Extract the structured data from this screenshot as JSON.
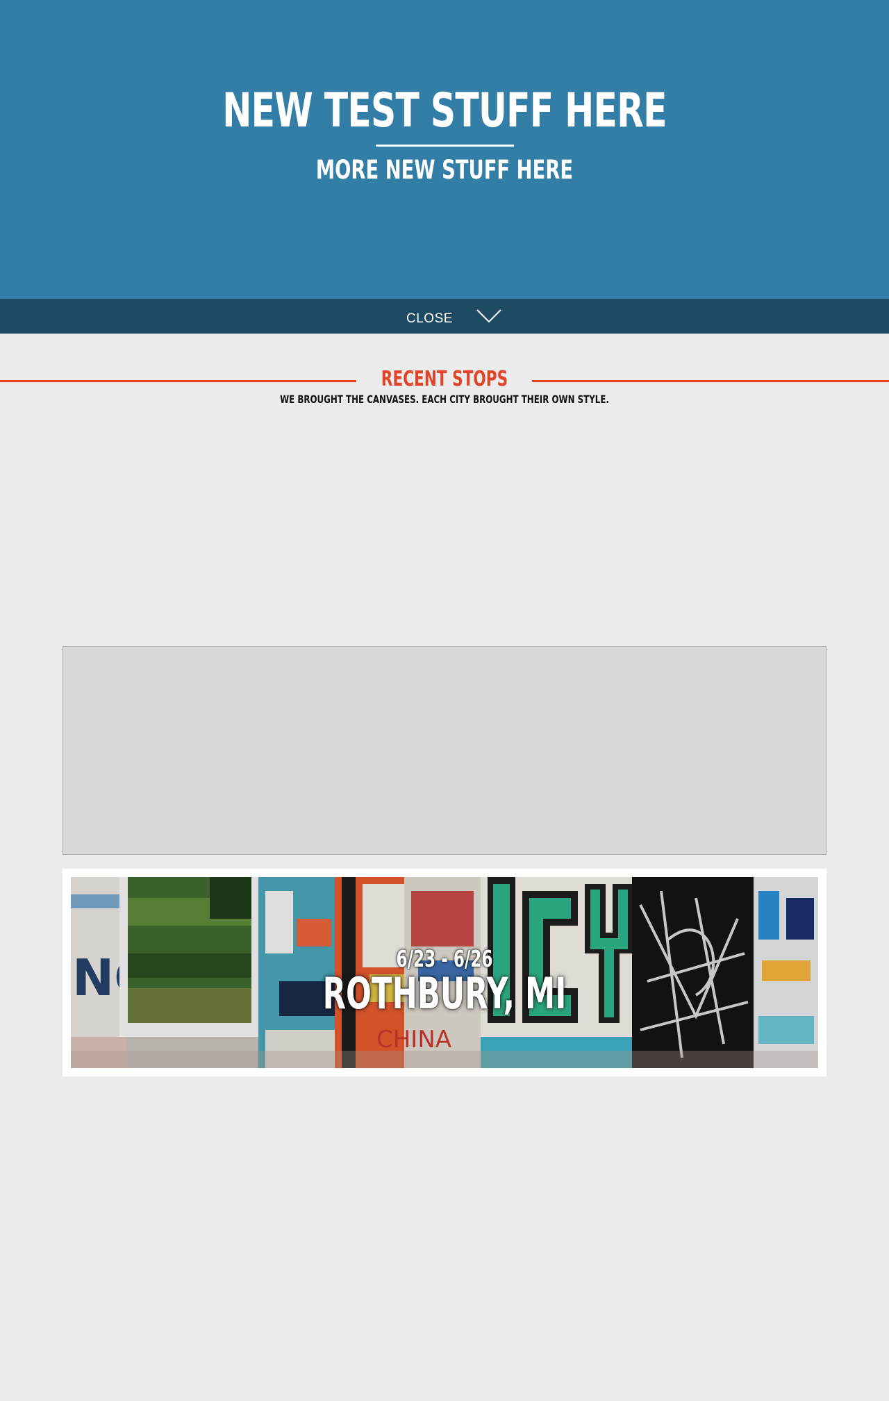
{
  "hero": {
    "title": "NEW TEST STUFF HERE",
    "subtitle": "MORE NEW STUFF HERE",
    "background_color": "#337ea6"
  },
  "close_bar": {
    "label": "CLOSE",
    "icon": "chevron-down-icon",
    "background_color": "#1f4a63"
  },
  "recent_stops": {
    "title": "RECENT STOPS",
    "subtitle": "WE BROUGHT THE CANVASES. EACH CITY BROUGHT THEIR OWN STYLE.",
    "accent_color": "#e0452a",
    "stops": [
      {
        "date": "6/23 - 6/26",
        "city": "ROTHBURY, MI"
      }
    ]
  }
}
